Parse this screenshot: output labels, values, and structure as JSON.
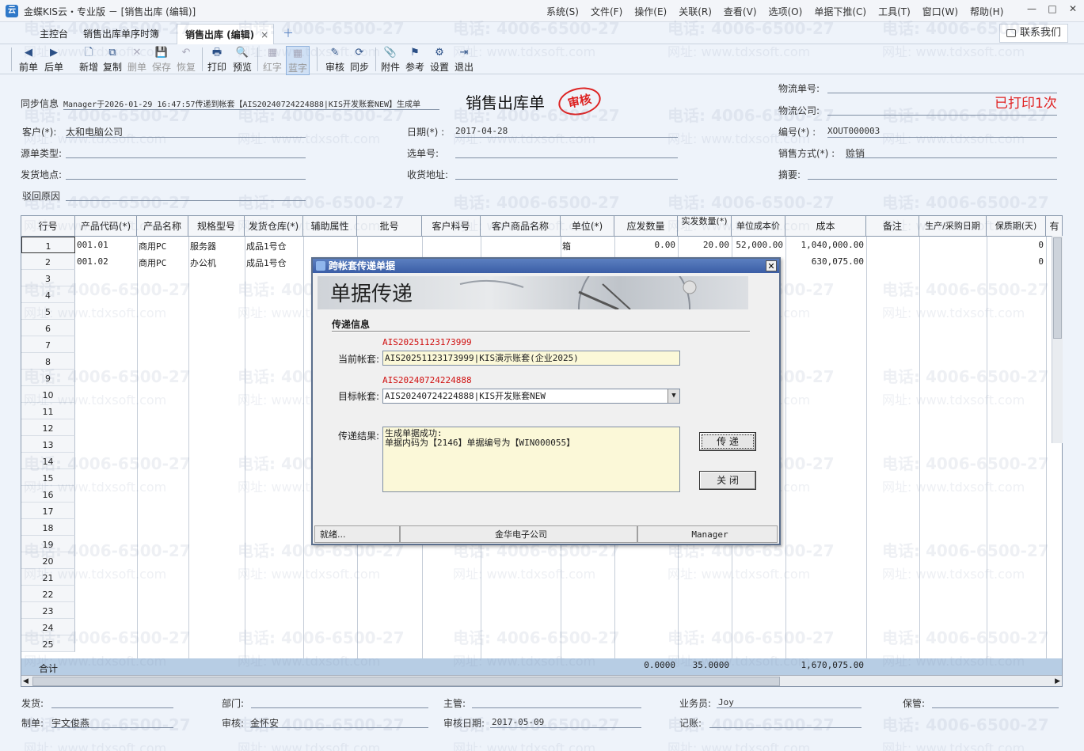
{
  "window": {
    "title": "金蝶KIS云・专业版 － [销售出库 (编辑)]",
    "logo": "云"
  },
  "menu": [
    "系统(S)",
    "文件(F)",
    "操作(E)",
    "关联(R)",
    "查看(V)",
    "选项(O)",
    "单据下推(C)",
    "工具(T)",
    "窗口(W)",
    "帮助(H)"
  ],
  "window_controls": [
    "—",
    "□",
    "✕"
  ],
  "tabs": [
    {
      "label": "主控台"
    },
    {
      "label": "销售出库单序时簿"
    },
    {
      "label": "销售出库 (编辑)"
    }
  ],
  "tab_add": "＋",
  "tab_close": "×",
  "contact_button": "联系我们",
  "toolbar": [
    {
      "label": "前单",
      "icon": "◀"
    },
    {
      "label": "后单",
      "icon": "▶"
    },
    {
      "label": "新增",
      "icon": "🗋"
    },
    {
      "label": "复制",
      "icon": "⧉"
    },
    {
      "label": "删单",
      "icon": "✕"
    },
    {
      "label": "保存",
      "icon": "💾"
    },
    {
      "label": "恢复",
      "icon": "↶"
    },
    {
      "label": "打印",
      "icon": "🖶"
    },
    {
      "label": "预览",
      "icon": "🔍"
    },
    {
      "label": "红字",
      "icon": "▦"
    },
    {
      "label": "蓝字",
      "icon": "▦"
    },
    {
      "label": "审核",
      "icon": "✎"
    },
    {
      "label": "同步",
      "icon": "⟳"
    },
    {
      "label": "附件",
      "icon": "📎"
    },
    {
      "label": "参考",
      "icon": "⚑"
    },
    {
      "label": "设置",
      "icon": "⚙"
    },
    {
      "label": "退出",
      "icon": "⇥"
    }
  ],
  "header": {
    "sync_label": "同步信息",
    "sync_text": "Manager于2026-01-29 16:47:57传递到帐套【AIS20240724224888|KIS开发账套NEW】生成单",
    "doc_title": "销售出库单",
    "stamp": "审核",
    "printed": "已打印1次",
    "logistics_no_label": "物流单号:",
    "logistics_co_label": "物流公司:",
    "customer_label": "客户(*):",
    "customer": "太和电脑公司",
    "date_label": "日期(*) :",
    "date": "2017-04-28",
    "number_label": "编号(*) :",
    "number": "XOUT000003",
    "source_type_label": "源单类型:",
    "select_no_label": "选单号:",
    "sale_mode_label": "销售方式(*) :",
    "sale_mode": "赊销",
    "ship_place_label": "发货地点:",
    "receive_addr_label": "收货地址:",
    "summary_label": "摘要:",
    "reject_reason_label": "驳回原因"
  },
  "grid": {
    "columns": [
      "行号",
      "产品代码(*)",
      "产品名称",
      "规格型号",
      "发货仓库(*)",
      "辅助属性",
      "批号",
      "客户料号",
      "客户商品名称",
      "单位(*)",
      "应发数量",
      "实发数量(*)",
      "单位成本价",
      "成本",
      "备注",
      "生产/采购日期",
      "保质期(天)",
      "有"
    ],
    "rows": [
      {
        "no": "1",
        "code": "001.01",
        "name": "商用PC",
        "spec": "服务器",
        "warehouse": "成品1号仓",
        "unit": "箱",
        "due_qty": "0.00",
        "qty": "20.00",
        "unit_cost": "52,000.00",
        "cost": "1,040,000.00",
        "shelf": "0"
      },
      {
        "no": "2",
        "code": "001.02",
        "name": "商用PC",
        "spec": "办公机",
        "warehouse": "成品1号仓",
        "unit": "",
        "due_qty": "",
        "qty": "",
        "unit_cost": "",
        "cost": "630,075.00",
        "shelf": "0"
      }
    ],
    "empty_rows": [
      "3",
      "4",
      "5",
      "6",
      "7",
      "8",
      "9",
      "10",
      "11",
      "12",
      "13",
      "14",
      "15",
      "16",
      "17",
      "18",
      "19",
      "20",
      "21",
      "22",
      "23",
      "24",
      "25"
    ],
    "total_label": "合计",
    "total_due_qty": "0.0000",
    "total_qty": "35.0000",
    "total_cost": "1,670,075.00"
  },
  "dialog": {
    "title": "跨帐套传递单据",
    "banner": "单据传递",
    "section": "传递信息",
    "current_code": "AIS20251123173999",
    "current_label": "当前帐套:",
    "current_value": "AIS20251123173999|KIS演示账套(企业2025)",
    "target_code": "AIS20240724224888",
    "target_label": "目标帐套:",
    "target_value": "AIS20240724224888|KIS开发账套NEW",
    "result_label": "传递结果:",
    "result_line1": "生成单据成功:",
    "result_line2": "单据内码为【2146】单据编号为【WIN000055】",
    "send_button": "传 递",
    "close_button": "关 闭",
    "status_ready": "就绪...",
    "status_company": "金华电子公司",
    "status_user": "Manager"
  },
  "footer": {
    "ship_label": "发货:",
    "dept_label": "部门:",
    "supervisor_label": "主管:",
    "salesman_label": "业务员:",
    "salesman": "Joy",
    "keeper_label": "保管:",
    "maker_label": "制单:",
    "maker": "宇文俊燕",
    "auditor_label": "审核:",
    "auditor": "金怀安",
    "audit_date_label": "审核日期:",
    "audit_date": "2017-05-09",
    "bookkeeper_label": "记账:"
  },
  "watermark": {
    "phone": "电话: 4006-6500-27",
    "site": "网址: www.tdxsoft.com"
  },
  "colors": {
    "stamp": "#dd2222",
    "printed": "#e02020",
    "dialog_title": "#3b5ea6",
    "total_row": "#b7cde4"
  }
}
